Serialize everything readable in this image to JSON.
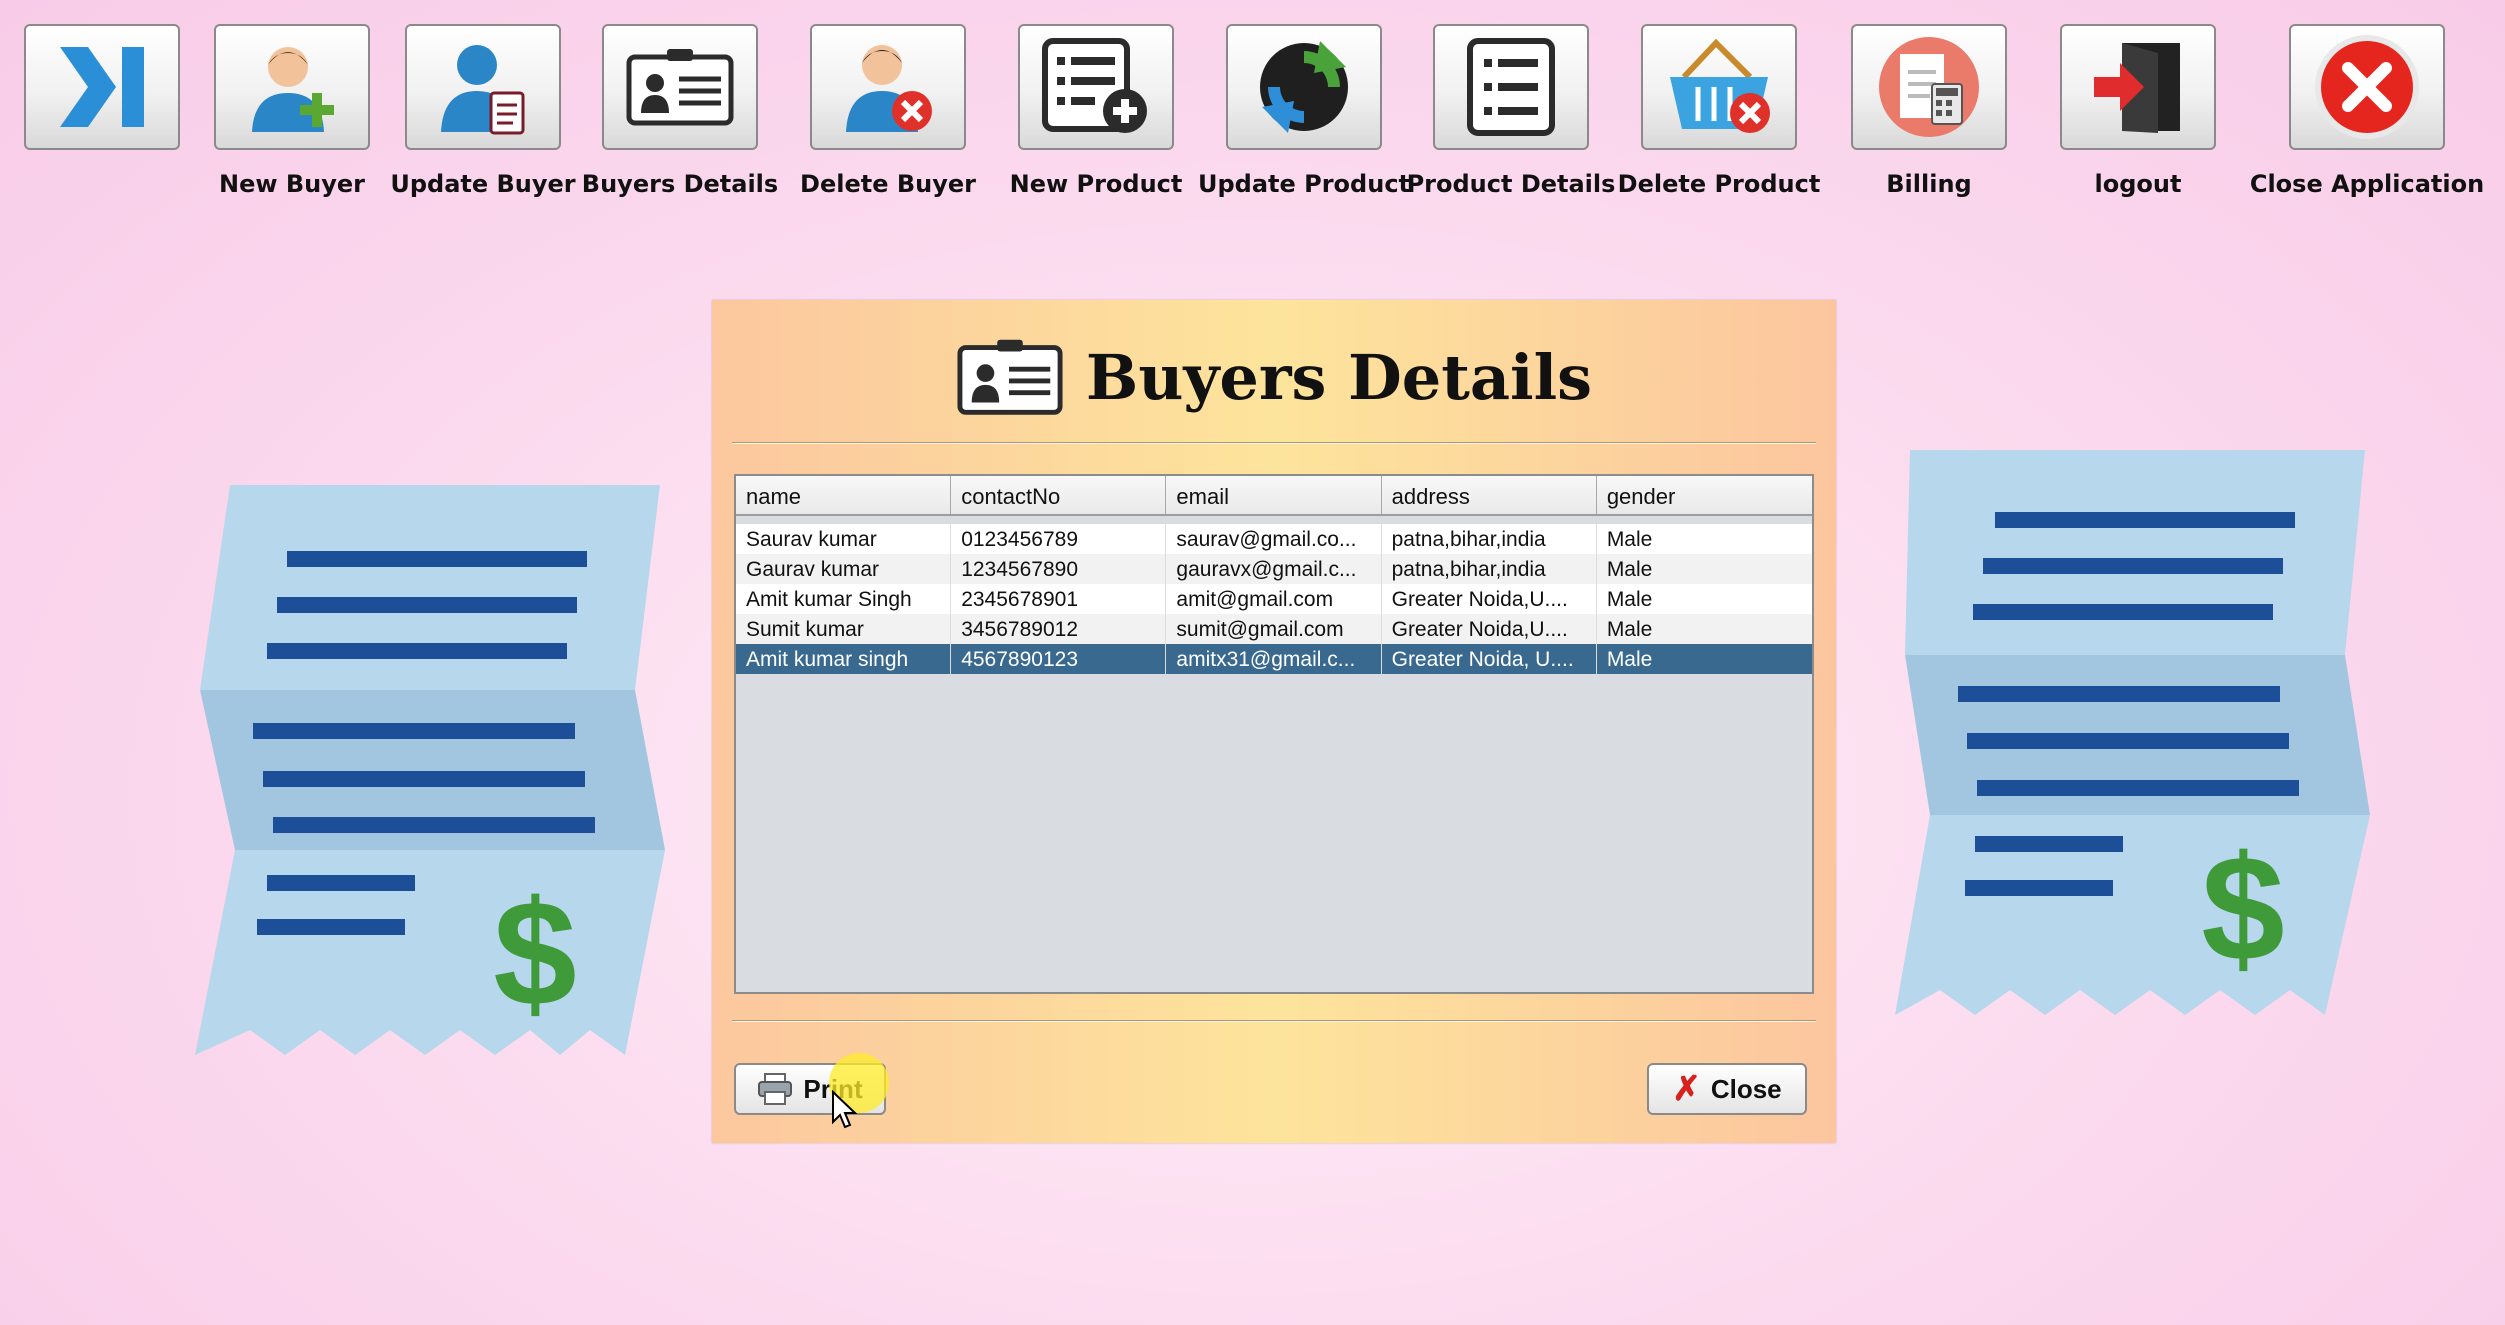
{
  "toolbar": {
    "items": [
      {
        "label": "",
        "icon": "collapse-arrow-icon"
      },
      {
        "label": "New Buyer",
        "icon": "add-user-icon"
      },
      {
        "label": "Update Buyer",
        "icon": "update-user-icon"
      },
      {
        "label": "Buyers Details",
        "icon": "id-card-icon"
      },
      {
        "label": "Delete Buyer",
        "icon": "delete-user-icon"
      },
      {
        "label": "New Product",
        "icon": "add-list-icon"
      },
      {
        "label": "Update Product",
        "icon": "refresh-icon"
      },
      {
        "label": "Product Details",
        "icon": "list-icon"
      },
      {
        "label": "Delete Product",
        "icon": "delete-basket-icon"
      },
      {
        "label": "Billing",
        "icon": "billing-icon"
      },
      {
        "label": "logout",
        "icon": "logout-door-icon"
      },
      {
        "label": "Close Application",
        "icon": "close-circle-icon"
      }
    ]
  },
  "dialog": {
    "title": "Buyers Details",
    "title_icon": "id-card-icon",
    "table": {
      "columns": [
        "name",
        "contactNo",
        "email",
        "address",
        "gender"
      ],
      "rows": [
        [
          "Saurav kumar",
          "0123456789",
          "saurav@gmail.co...",
          "patna,bihar,india",
          "Male"
        ],
        [
          "Gaurav kumar",
          "1234567890",
          "gauravx@gmail.c...",
          "patna,bihar,india",
          "Male"
        ],
        [
          "Amit kumar Singh",
          "2345678901",
          "amit@gmail.com",
          "Greater Noida,U....",
          "Male"
        ],
        [
          "Sumit kumar",
          "3456789012",
          "sumit@gmail.com",
          "Greater Noida,U....",
          "Male"
        ],
        [
          "Amit kumar singh",
          "4567890123",
          "amitx31@gmail.c...",
          "Greater Noida, U....",
          "Male"
        ]
      ],
      "selected_row": 4
    },
    "print_label": "Print",
    "close_label": "Close"
  },
  "colors": {
    "selection": "#39698f",
    "receipt_paper": "#b7d7ec",
    "receipt_lines": "#1c4f98",
    "dollar": "#3f9a3a"
  }
}
